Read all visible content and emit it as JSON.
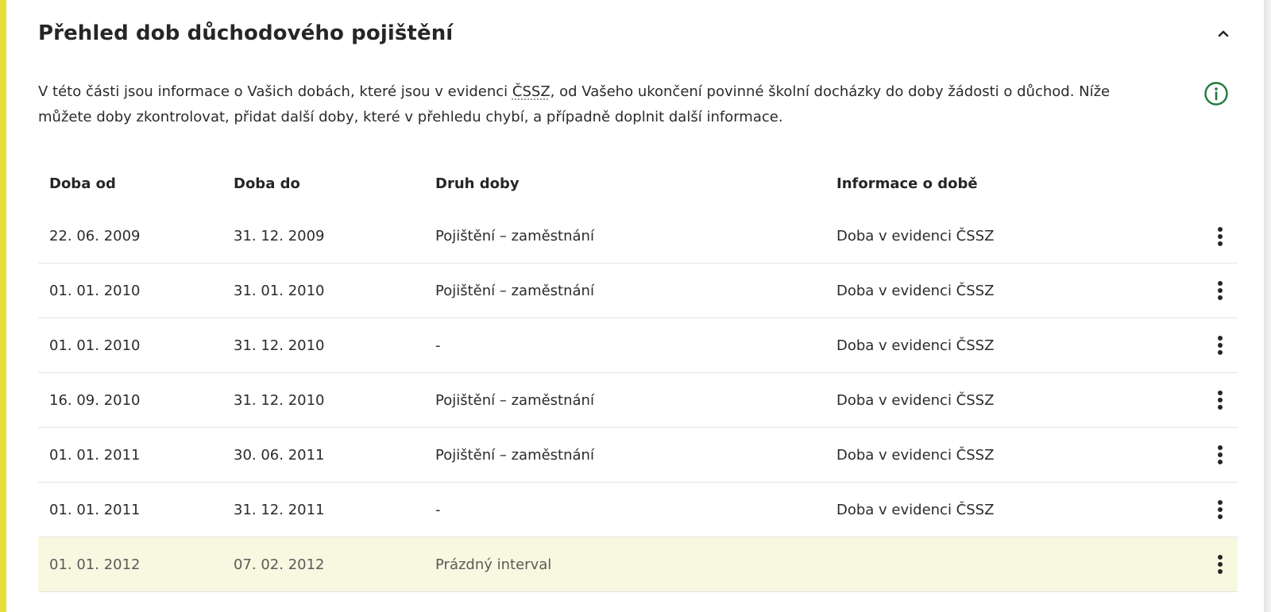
{
  "section": {
    "title": "Přehled dob důchodového pojištění",
    "intro_before": "V této části jsou informace o Vašich dobách, které jsou v evidenci ",
    "intro_abbr": "ČSSZ",
    "intro_after": ", od Vašeho ukončení povinné školní docházky do doby žádosti o důchod. Níže můžete doby zkontrolovat, přidat další doby, které v přehledu chybí, a případně doplnit další informace.",
    "collapse_icon": "chevron-up-icon",
    "info_icon": "info-circle-icon"
  },
  "colors": {
    "accent_bar": "#e6dc3a",
    "info_icon": "#1f7a3a",
    "highlight_row": "#f8f8e0"
  },
  "table": {
    "headers": {
      "from": "Doba od",
      "to": "Doba do",
      "type": "Druh doby",
      "info": "Informace o době"
    },
    "rows": [
      {
        "from": "22. 06. 2009",
        "to": "31. 12. 2009",
        "type": "Pojištění – zaměstnání",
        "info": "Doba v evidenci ČSSZ"
      },
      {
        "from": "01. 01. 2010",
        "to": "31. 01. 2010",
        "type": "Pojištění – zaměstnání",
        "info": "Doba v evidenci ČSSZ"
      },
      {
        "from": "01. 01. 2010",
        "to": "31. 12. 2010",
        "type": "-",
        "info": "Doba v evidenci ČSSZ"
      },
      {
        "from": "16. 09. 2010",
        "to": "31. 12. 2010",
        "type": "Pojištění – zaměstnání",
        "info": "Doba v evidenci ČSSZ"
      },
      {
        "from": "01. 01. 2011",
        "to": "30. 06. 2011",
        "type": "Pojištění – zaměstnání",
        "info": "Doba v evidenci ČSSZ"
      },
      {
        "from": "01. 01. 2011",
        "to": "31. 12. 2011",
        "type": "-",
        "info": "Doba v evidenci ČSSZ"
      },
      {
        "from": "01. 01. 2012",
        "to": "07. 02. 2012",
        "type": "Prázdný interval",
        "info": ""
      }
    ],
    "row_menu_icon": "kebab-menu-icon"
  }
}
